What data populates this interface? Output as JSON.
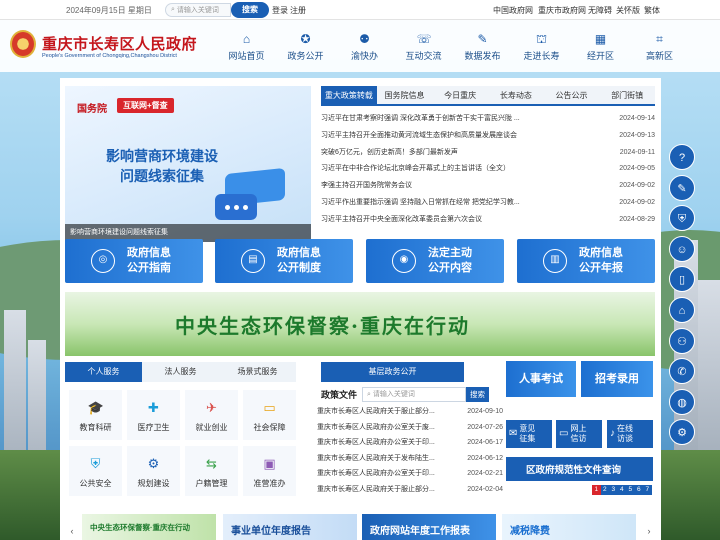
{
  "topbar": {
    "date": "2024年09月15日 星期日",
    "search_placeholder": "请输入关键词",
    "search_button": "搜索",
    "login": "登录",
    "register": "注册",
    "links": [
      "中国政府网",
      "重庆市政府网",
      "无障碍",
      "关怀版",
      "繁体"
    ]
  },
  "header": {
    "title": "重庆市长寿区人民政府",
    "subtitle": "People's Government of Chongqing,Changshou District",
    "nav": [
      {
        "label": "网站首页",
        "icon": "home-icon",
        "glyph": "⌂"
      },
      {
        "label": "政务公开",
        "icon": "gov-open-icon",
        "glyph": "✪"
      },
      {
        "label": "渝快办",
        "icon": "service-icon",
        "glyph": "⚉"
      },
      {
        "label": "互动交流",
        "icon": "chat-icon",
        "glyph": "☏"
      },
      {
        "label": "数据发布",
        "icon": "data-icon",
        "glyph": "✎"
      },
      {
        "label": "走进长寿",
        "icon": "city-icon",
        "glyph": "⛫"
      },
      {
        "label": "经开区",
        "icon": "economic-zone-icon",
        "glyph": "▦"
      },
      {
        "label": "高新区",
        "icon": "hitech-zone-icon",
        "glyph": "⌗"
      }
    ]
  },
  "banner": {
    "gwy": "国务院",
    "tag": "互联网+督查",
    "headline_1": "影响营商环境建设",
    "headline_2": "问题线索征集",
    "caption": "影响营商环境建设问题线索征集"
  },
  "news": {
    "tabs": [
      "重大政策转载",
      "国务院信息",
      "今日重庆",
      "长寿动态",
      "公告公示",
      "部门街镇"
    ],
    "items": [
      {
        "title": "习近平在甘肃考察时强调 深化改革勇于创新苦干实干富民兴陇 ...",
        "date": "2024-09-14"
      },
      {
        "title": "习近平主持召开全面推动黄河流域生态保护和高质量发展座谈会",
        "date": "2024-09-13"
      },
      {
        "title": "突破6万亿元，创历史新高！多部门最新发声",
        "date": "2024-09-11"
      },
      {
        "title": "习近平在中非合作论坛北京峰会开幕式上的主旨讲话（全文）",
        "date": "2024-09-05"
      },
      {
        "title": "李强主持召开国务院常务会议",
        "date": "2024-09-02"
      },
      {
        "title": "习近平作出重要指示强调 坚持融入日常抓在经常 把党纪学习教...",
        "date": "2024-09-02"
      },
      {
        "title": "习近平主持召开中央全面深化改革委员会第六次会议",
        "date": "2024-08-29"
      }
    ]
  },
  "info_buttons": [
    {
      "line1": "政府信息",
      "line2": "公开指南",
      "icon": "compass-icon",
      "glyph": "◎"
    },
    {
      "line1": "政府信息",
      "line2": "公开制度",
      "icon": "book-icon",
      "glyph": "▤"
    },
    {
      "line1": "法定主动",
      "line2": "公开内容",
      "icon": "notice-icon",
      "glyph": "◉"
    },
    {
      "line1": "政府信息",
      "line2": "公开年报",
      "icon": "report-icon",
      "glyph": "▥"
    }
  ],
  "eco_banner": "中央生态环保督察·重庆在行动",
  "services": {
    "tabs": [
      "个人服务",
      "法人服务",
      "场景式服务"
    ],
    "items": [
      {
        "label": "教育科研",
        "icon": "education-icon",
        "glyph": "🎓",
        "color": "#c9302c"
      },
      {
        "label": "医疗卫生",
        "icon": "medical-icon",
        "glyph": "✚",
        "color": "#1a9dd9"
      },
      {
        "label": "就业创业",
        "icon": "employment-icon",
        "glyph": "✈",
        "color": "#d9534f"
      },
      {
        "label": "社会保障",
        "icon": "social-security-icon",
        "glyph": "▭",
        "color": "#e8a317"
      },
      {
        "label": "公共安全",
        "icon": "shield-icon",
        "glyph": "⛨",
        "color": "#1a9dd9"
      },
      {
        "label": "规划建设",
        "icon": "planning-icon",
        "glyph": "⚙",
        "color": "#1a5fb4"
      },
      {
        "label": "户籍管理",
        "icon": "household-icon",
        "glyph": "⇆",
        "color": "#3aa14a"
      },
      {
        "label": "准营准办",
        "icon": "license-icon",
        "glyph": "▣",
        "color": "#8e5bb5"
      }
    ]
  },
  "grassroots": {
    "title": "基层政务公开",
    "policy_label": "政策文件",
    "search_placeholder": "请输入关键词",
    "search_button": "搜索",
    "docs": [
      {
        "title": "重庆市长寿区人民政府关于服止部分...",
        "date": "2024-09-10"
      },
      {
        "title": "重庆市长寿区人民政府办公室关于废...",
        "date": "2024-07-26"
      },
      {
        "title": "重庆市长寿区人民政府办公室关于印...",
        "date": "2024-06-17"
      },
      {
        "title": "重庆市长寿区人民政府关于发布陆生...",
        "date": "2024-06-12"
      },
      {
        "title": "重庆市长寿区人民政府办公室关于印...",
        "date": "2024-02-21"
      },
      {
        "title": "重庆市长寿区人民政府关于服止部分...",
        "date": "2024-02-04"
      }
    ]
  },
  "right_blocks": {
    "exam": "人事考试",
    "recruit": "招考录用",
    "mailbox": [
      {
        "line1": "意见",
        "line2": "征集",
        "icon": "opinion-icon",
        "glyph": "✉"
      },
      {
        "line1": "网上",
        "line2": "信访",
        "icon": "petition-icon",
        "glyph": "▭"
      },
      {
        "line1": "在线",
        "line2": "访谈",
        "icon": "mic-icon",
        "glyph": "♪"
      }
    ],
    "query": "区政府规范性文件查询",
    "pager": [
      "1",
      "2",
      "3",
      "4",
      "5",
      "6",
      "7"
    ]
  },
  "carousel": {
    "cards": [
      "中央生态环保督察·重庆在行动",
      "事业单位年度报告",
      "政府网站年度工作报表",
      "减税降费"
    ]
  },
  "sidebar": [
    {
      "icon": "qa-icon",
      "glyph": "?"
    },
    {
      "icon": "education-icon",
      "glyph": "✎"
    },
    {
      "icon": "shield-icon",
      "glyph": "⛨"
    },
    {
      "icon": "elderly-icon",
      "glyph": "☺"
    },
    {
      "icon": "mobile-icon",
      "glyph": "▯"
    },
    {
      "icon": "building-icon",
      "glyph": "⌂"
    },
    {
      "icon": "network-icon",
      "glyph": "⚇"
    },
    {
      "icon": "wechat-icon",
      "glyph": "✆"
    },
    {
      "icon": "weibo-icon",
      "glyph": "◍"
    },
    {
      "icon": "settings-icon",
      "glyph": "⚙"
    }
  ]
}
